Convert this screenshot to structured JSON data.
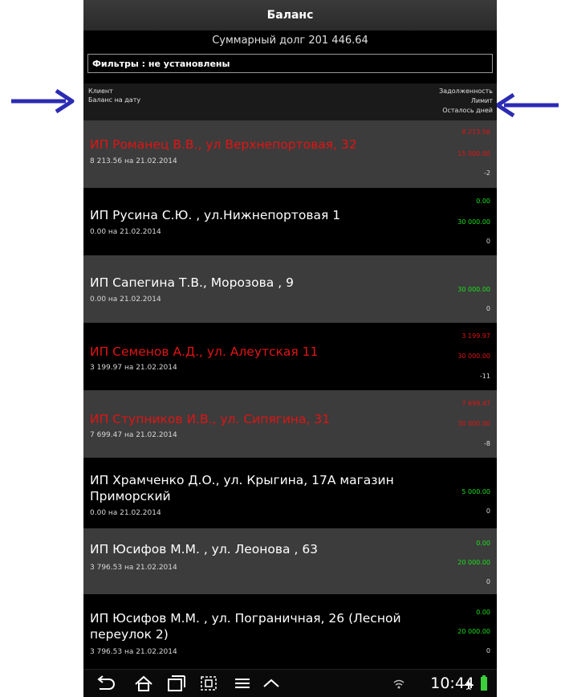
{
  "header": {
    "title": "Баланс",
    "total_debt": "Суммарный долг 201 446.64"
  },
  "filter": {
    "label": "Фильтры : не установлены"
  },
  "columns": {
    "client": "Клиент",
    "balance_on_date": "Баланс на дату",
    "debt": "Задолженность",
    "limit": "Лимит",
    "days_left": "Осталось дней"
  },
  "rows": [
    {
      "name": "ИП Романец В.В., ул Верхнепортовая, 32",
      "balance": "8 213.56 на 21.02.2014",
      "debt": "8 213.56",
      "limit": "15 000.00",
      "days": "-2"
    },
    {
      "name": "ИП Русина С.Ю. , ул.Нижнепортовая 1",
      "balance": "0.00 на 21.02.2014",
      "debt": "0.00",
      "limit": "30 000.00",
      "days": "0"
    },
    {
      "name": "ИП Сапегина Т.В., Морозова , 9",
      "balance": "0.00 на 21.02.2014",
      "debt": "",
      "limit": "30 000.00",
      "days": "0"
    },
    {
      "name": "ИП Семенов А.Д., ул. Алеутская 11",
      "balance": "3 199.97 на 21.02.2014",
      "debt": "3 199.97",
      "limit": "30 000.00",
      "days": "-11"
    },
    {
      "name": "ИП Ступников И.В., ул. Сипягина, 31",
      "balance": "7 699.47 на 21.02.2014",
      "debt": "7 699.47",
      "limit": "30 000.00",
      "days": "-8"
    },
    {
      "name": "ИП Храмченко Д.О., ул. Крыгина, 17А магазин Приморский",
      "balance": "0.00 на 21.02.2014",
      "debt": "",
      "limit": "5 000.00",
      "days": "0"
    },
    {
      "name": "ИП Юсифов М.М. , ул. Леонова , 63",
      "balance": "3 796.53 на 21.02.2014",
      "debt": "0.00",
      "limit": "20 000.00",
      "days": "0"
    },
    {
      "name": "ИП Юсифов М.М. , ул. Пограничная, 26 (Лесной переулок 2)",
      "balance": "3 796.53 на 21.02.2014",
      "debt": "0.00",
      "limit": "20 000.00",
      "days": "0"
    }
  ],
  "statusbar": {
    "time": "10:44"
  },
  "colors": {
    "overdue": "#e11414",
    "ok": "#19e219",
    "arrow": "#2b2bb4"
  }
}
